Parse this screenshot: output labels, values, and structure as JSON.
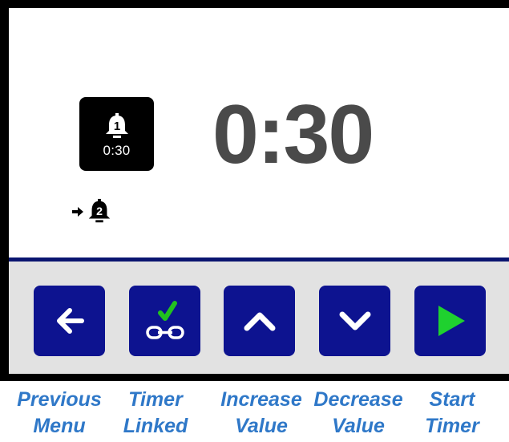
{
  "display": {
    "active_timer": {
      "number": "1",
      "duration": "0:30"
    },
    "countdown": "0:30",
    "next_timer": {
      "number": "2"
    }
  },
  "buttons": [
    {
      "id": "previous-menu",
      "icon": "arrow-left-icon",
      "caption_line1": "Previous",
      "caption_line2": "Menu"
    },
    {
      "id": "timer-linked",
      "icon": "linked-check-icon",
      "caption_line1": "Timer",
      "caption_line2": "Linked"
    },
    {
      "id": "increase-value",
      "icon": "chevron-up-icon",
      "caption_line1": "Increase",
      "caption_line2": "Value"
    },
    {
      "id": "decrease-value",
      "icon": "chevron-down-icon",
      "caption_line1": "Decrease",
      "caption_line2": "Value"
    },
    {
      "id": "start-timer",
      "icon": "play-icon",
      "caption_line1": "Start",
      "caption_line2": "Timer"
    }
  ],
  "colors": {
    "bezel": "#000000",
    "button_bg": "#0d1390",
    "button_bar_bg": "#e2e2e2",
    "divider": "#0a1570",
    "countdown_text": "#4a4a4a",
    "check_green": "#22c21f",
    "play_green": "#1fd12f",
    "caption_blue": "#2f78c8"
  }
}
